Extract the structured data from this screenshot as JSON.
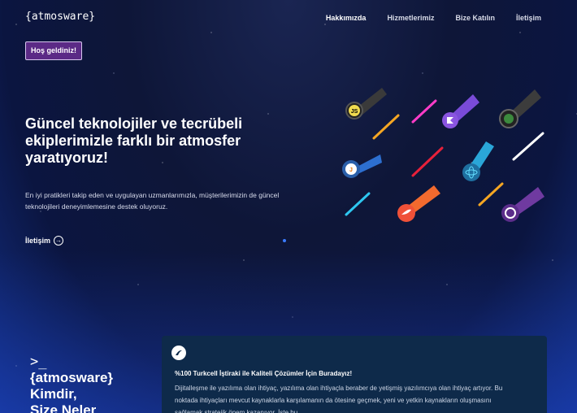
{
  "header": {
    "logo": "{atmosware}",
    "nav": [
      "Hakkımızda",
      "Hizmetlerimiz",
      "Bize Katılın",
      "İletişim"
    ]
  },
  "hero": {
    "badge": "Hoş geldiniz!",
    "title": "Güncel teknolojiler ve tecrübeli ekiplerimizle farklı bir atmosfer yaratıyoruz!",
    "description": "En iyi pratikleri takip eden ve uygulayan uzmanlarımızla, müşterilerimizin de güncel teknolojileri deneyimlemesine destek oluyoruz.",
    "cta": "İletişim"
  },
  "about": {
    "prompt": ">_",
    "brand": "{atmosware}",
    "title_rest": "Kimdir,\nSize Neler"
  },
  "card": {
    "heading": "%100 Turkcell İştiraki ile Kaliteli Çözümler İçin Buradayız!",
    "text": "Dijitalleşme ile yazılıma olan ihtiyaç, yazılıma olan ihtiyaçla beraber de yetişmiş yazılımcıya olan ihtiyaç artıyor. Bu noktada ihtiyaçları mevcut kaynaklarla karşılamanın da ötesine geçmek, yeni ve yetkin kaynakların oluşmasını sağlamak stratejik önem kazanıyor. İşte bu"
  },
  "colors": {
    "badge_bg": "#5b2a86",
    "card_bg": "#0e2a4a"
  },
  "icons": [
    "js-icon",
    "java-icon",
    "react-icon",
    "swift-icon",
    "kotlin-icon",
    "nodejs-icon",
    "cplus-icon",
    "turkcell-icon"
  ]
}
